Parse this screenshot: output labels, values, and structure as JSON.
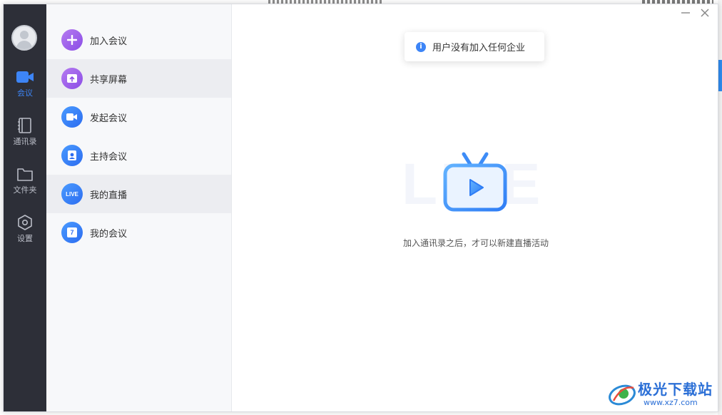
{
  "rail": {
    "items": [
      {
        "label": "会议",
        "icon": "video-camera-icon",
        "active": true
      },
      {
        "label": "通讯录",
        "icon": "address-book-icon"
      },
      {
        "label": "文件夹",
        "icon": "folder-icon"
      },
      {
        "label": "设置",
        "icon": "settings-hexagon-icon"
      }
    ]
  },
  "menu": {
    "items": [
      {
        "label": "加入会议",
        "icon": "plus-icon"
      },
      {
        "label": "共享屏幕",
        "icon": "share-screen-icon"
      },
      {
        "label": "发起会议",
        "icon": "video-icon"
      },
      {
        "label": "主持会议",
        "icon": "host-icon"
      },
      {
        "label": "我的直播",
        "icon": "live-icon",
        "icon_text": "LIVE"
      },
      {
        "label": "我的会议",
        "icon": "calendar-icon",
        "icon_text": "7"
      }
    ]
  },
  "content": {
    "toast": "用户没有加入任何企业",
    "watermark_bg": "LIVE",
    "hint": "加入通讯录之后，才可以新建直播活动"
  },
  "watermark": {
    "title": "极光下载站",
    "url": "www.xz7.com"
  },
  "colors": {
    "rail_bg": "#2d2f38",
    "accent": "#3d85f7",
    "menu_bg": "#f7f8fa",
    "menu_highlight": "#ecedf1",
    "purple": "#8b4de6"
  }
}
